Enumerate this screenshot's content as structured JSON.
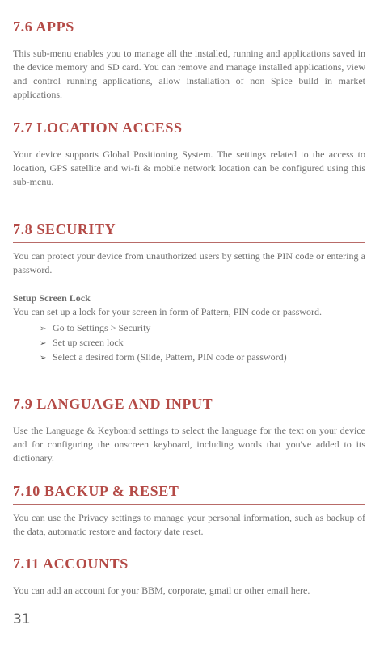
{
  "sections": {
    "apps": {
      "title": "7.6 APPS",
      "body": "This sub-menu enables you to manage all the installed, running and applications saved in the device memory and SD card. You can remove and manage installed applications, view and control running applications, allow installation of non Spice build in market applications."
    },
    "location": {
      "title": "7.7 LOCATION ACCESS",
      "body": "Your device supports Global Positioning System. The settings related to the access to location, GPS satellite and wi-fi & mobile network location can be configured using this sub-menu."
    },
    "security": {
      "title": "7.8 SECURITY",
      "body": "You can protect your device from unauthorized users by setting the PIN code or entering a password.",
      "subhead": "Setup Screen Lock",
      "subbody": "You can set up a lock for your screen in form of Pattern, PIN code or password.",
      "steps": [
        "Go to Settings > Security",
        "Set up screen lock",
        "Select a desired form (Slide, Pattern, PIN code or password)"
      ]
    },
    "language": {
      "title": "7.9 LANGUAGE AND INPUT",
      "body": "Use the Language & Keyboard settings to select the language for the text on your device and for configuring the onscreen keyboard, including words that you've added to its dictionary."
    },
    "backup": {
      "title": "7.10 BACKUP & RESET",
      "body": "You can use the Privacy settings to manage your personal information, such as backup of the data, automatic restore and factory date reset."
    },
    "accounts": {
      "title": "7.11 ACCOUNTS",
      "body": "You can add an account for your BBM, corporate, gmail or other email here."
    }
  },
  "bullet_icon": "arrow-right-icon",
  "bullet_glyph": "➢",
  "page_number": "31",
  "colors": {
    "heading": "#b44a46",
    "rule": "#b86b68",
    "body_text": "#6e6e6e"
  }
}
